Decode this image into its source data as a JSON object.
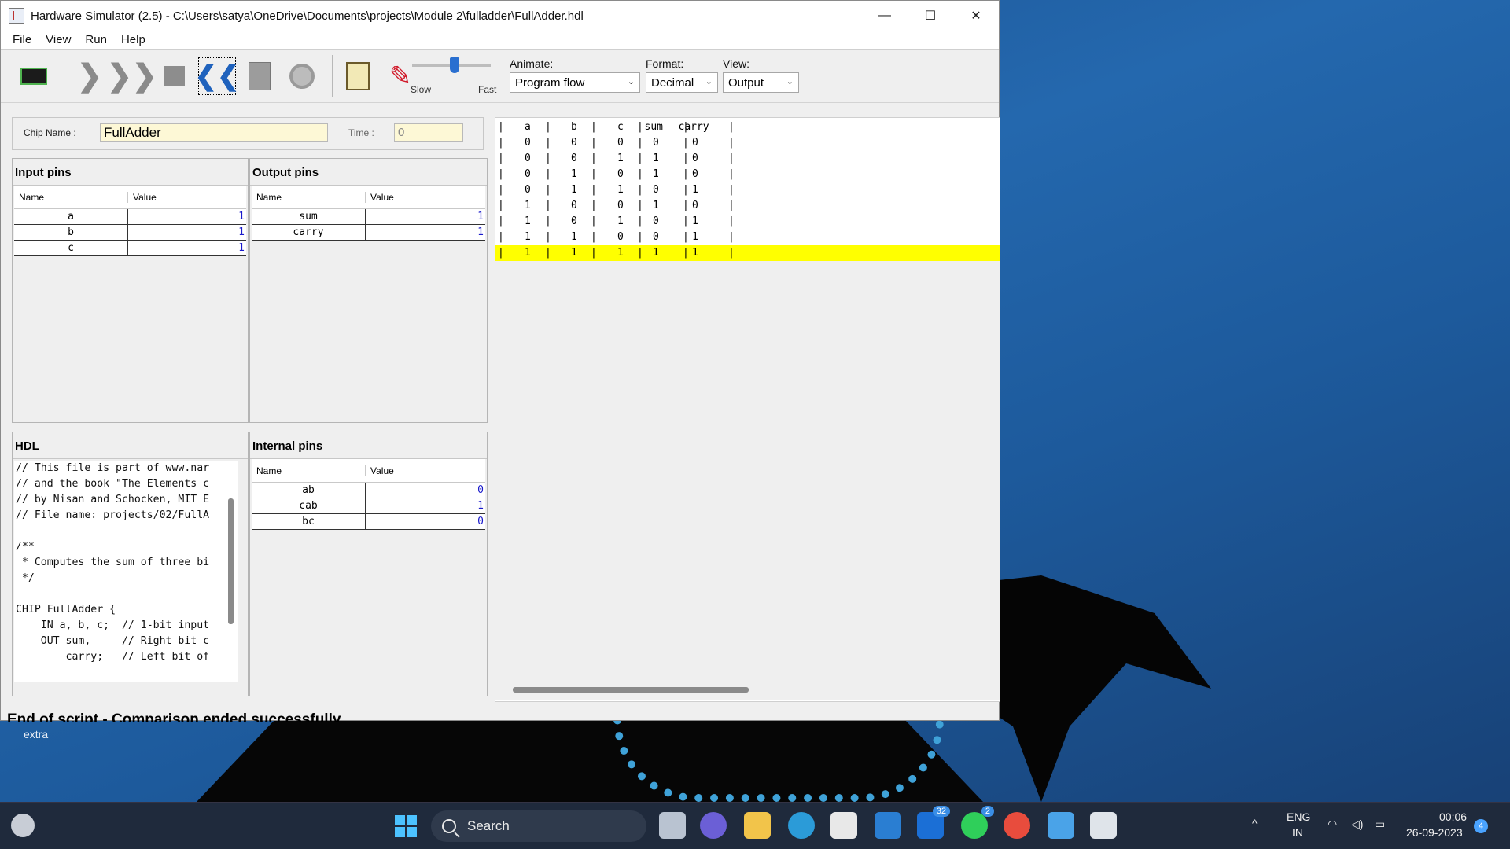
{
  "window": {
    "title": "Hardware Simulator (2.5) - C:\\Users\\satya\\OneDrive\\Documents\\projects\\Module 2\\fulladder\\FullAdder.hdl",
    "minimize": "—",
    "maximize": "☐",
    "close": "✕"
  },
  "menu": [
    "File",
    "View",
    "Run",
    "Help"
  ],
  "toolbar": {
    "speed_slow": "Slow",
    "speed_fast": "Fast",
    "speed_level": 0.5,
    "animate_label": "Animate:",
    "animate_value": "Program flow",
    "format_label": "Format:",
    "format_value": "Decimal",
    "view_label": "View:",
    "view_value": "Output",
    "icons": [
      "chip-load-icon",
      "single-step-icon",
      "run-icon",
      "stop-icon",
      "reset-icon",
      "calculator-icon",
      "clock-icon",
      "script-icon",
      "breakpoint-icon"
    ]
  },
  "chip": {
    "name_label": "Chip Name :",
    "name_value": "FullAdder",
    "time_label": "Time :",
    "time_value": "0"
  },
  "input_pins": {
    "title": "Input pins",
    "col_name": "Name",
    "col_value": "Value",
    "rows": [
      {
        "name": "a",
        "value": "1"
      },
      {
        "name": "b",
        "value": "1"
      },
      {
        "name": "c",
        "value": "1"
      }
    ]
  },
  "output_pins": {
    "title": "Output pins",
    "col_name": "Name",
    "col_value": "Value",
    "rows": [
      {
        "name": "sum",
        "value": "1"
      },
      {
        "name": "carry",
        "value": "1"
      }
    ]
  },
  "hdl": {
    "title": "HDL",
    "lines": [
      "// This file is part of www.nar",
      "// and the book \"The Elements c",
      "// by Nisan and Schocken, MIT E",
      "// File name: projects/02/FullA",
      "",
      "/**",
      " * Computes the sum of three bi",
      " */",
      "",
      "CHIP FullAdder {",
      "    IN a, b, c;  // 1-bit input",
      "    OUT sum,     // Right bit c",
      "        carry;   // Left bit of"
    ]
  },
  "internal_pins": {
    "title": "Internal pins",
    "col_name": "Name",
    "col_value": "Value",
    "rows": [
      {
        "name": "ab",
        "value": "0"
      },
      {
        "name": "cab",
        "value": "1"
      },
      {
        "name": "bc",
        "value": "0"
      }
    ]
  },
  "compare": {
    "headers": [
      "a",
      "b",
      "c",
      "sum",
      "carry"
    ],
    "rows": [
      [
        "0",
        "0",
        "0",
        "0",
        "0"
      ],
      [
        "0",
        "0",
        "1",
        "1",
        "0"
      ],
      [
        "0",
        "1",
        "0",
        "1",
        "0"
      ],
      [
        "0",
        "1",
        "1",
        "0",
        "1"
      ],
      [
        "1",
        "0",
        "0",
        "1",
        "0"
      ],
      [
        "1",
        "0",
        "1",
        "0",
        "1"
      ],
      [
        "1",
        "1",
        "0",
        "0",
        "1"
      ],
      [
        "1",
        "1",
        "1",
        "1",
        "1"
      ]
    ],
    "highlighted_row": 7
  },
  "status": "End of script - Comparison ended successfully",
  "desktop": {
    "extra_label": "extra"
  },
  "taskbar": {
    "search_placeholder": "Search",
    "outlook_badge": "32",
    "whatsapp_badge": "2",
    "language": "ENG",
    "region": "IN",
    "time": "00:06",
    "date": "26-09-2023",
    "notification_count": "4"
  }
}
